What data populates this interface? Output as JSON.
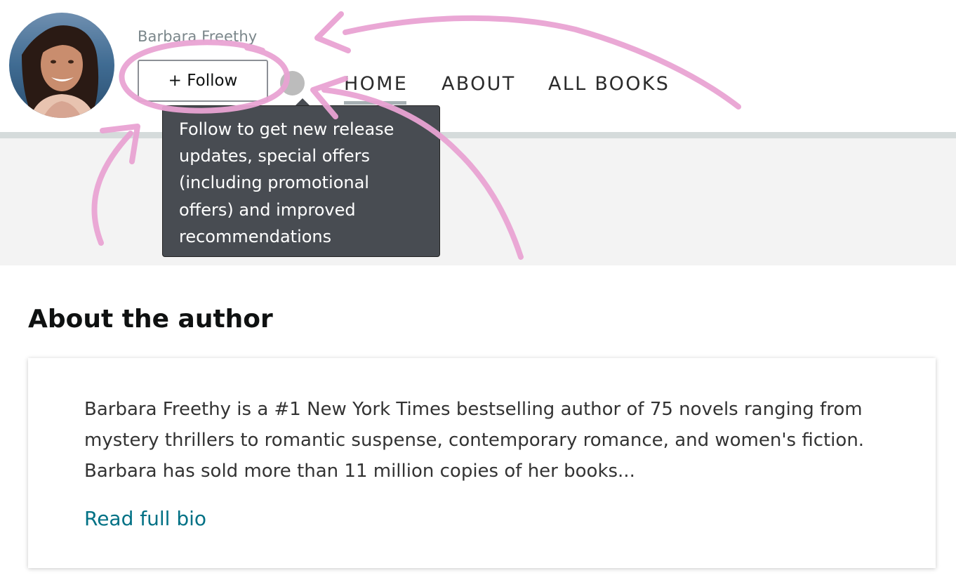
{
  "author": {
    "name": "Barbara Freethy",
    "avatar_label": "author-photo"
  },
  "follow": {
    "label": "+ Follow",
    "tooltip": "Follow to get new release updates, special offers (including promotional offers) and improved recommendations"
  },
  "nav": {
    "items": [
      {
        "label": "HOME",
        "active": true
      },
      {
        "label": "ABOUT",
        "active": false
      },
      {
        "label": "ALL BOOKS",
        "active": false
      }
    ]
  },
  "about": {
    "title": "About the author",
    "bio": "Barbara Freethy is a #1 New York Times bestselling author of 75 novels ranging from mystery thrillers to romantic suspense, contemporary romance, and women's fiction. Barbara has sold more than 11 million copies of her books...",
    "read_more": "Read full bio"
  },
  "colors": {
    "link": "#007185",
    "tooltip_bg": "#484c52",
    "annotation": "#e9a3d3",
    "nav_underline": "#a7b0b3"
  },
  "icons": {
    "info": "info-icon"
  }
}
